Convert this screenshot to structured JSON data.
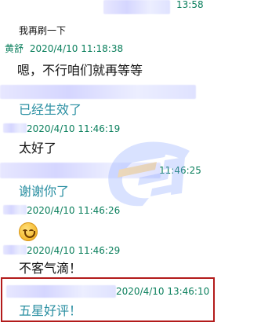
{
  "chat": {
    "top_cut_time": "13:58",
    "messages": [
      {
        "kind": "text",
        "text": "我再刷一下"
      },
      {
        "kind": "header",
        "sender": "黄舒",
        "time": "2020/4/10 11:18:38"
      },
      {
        "kind": "text",
        "text": "嗯，不行咱们就再等等"
      },
      {
        "kind": "text",
        "text": "已经生效了"
      },
      {
        "kind": "header",
        "sender": "",
        "time": "2020/4/10 11:46:19"
      },
      {
        "kind": "text",
        "text": "太好了"
      },
      {
        "kind": "time",
        "time": "11:46:25"
      },
      {
        "kind": "text",
        "text": "谢谢你了"
      },
      {
        "kind": "header",
        "sender": "",
        "time": "2020/4/10 11:46:26"
      },
      {
        "kind": "header",
        "sender": "",
        "time": "2020/4/10 11:46:29"
      },
      {
        "kind": "text",
        "text": "不客气滴！"
      },
      {
        "kind": "header",
        "sender": "",
        "time": "2020/4/10 13:46:10"
      },
      {
        "kind": "text",
        "text": "五星好评！"
      }
    ]
  },
  "colors": {
    "accent_green": "#0a7f5c",
    "accent_teal": "#2a8fa2",
    "highlight_red": "#b31b1b"
  },
  "watermark": {
    "icon": "brand-watermark-icon"
  }
}
